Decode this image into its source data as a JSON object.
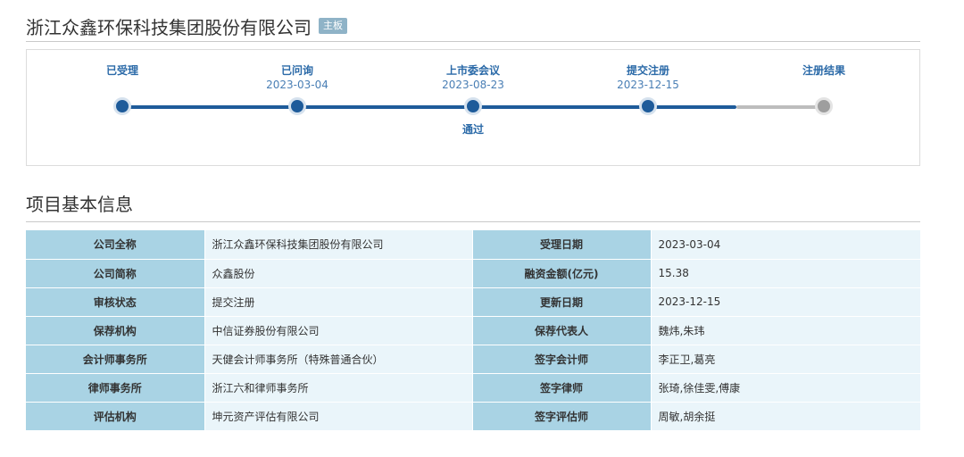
{
  "header": {
    "company_name": "浙江众鑫环保科技集团股份有限公司",
    "board_badge": "主板"
  },
  "progress": {
    "steps": [
      {
        "label": "已受理",
        "date": "",
        "result": "",
        "status": "done"
      },
      {
        "label": "已问询",
        "date": "2023-03-04",
        "result": "",
        "status": "done"
      },
      {
        "label": "上市委会议",
        "date": "2023-08-23",
        "result": "通过",
        "status": "done"
      },
      {
        "label": "提交注册",
        "date": "2023-12-15",
        "result": "",
        "status": "done"
      },
      {
        "label": "注册结果",
        "date": "",
        "result": "",
        "status": "pending"
      }
    ],
    "colors": {
      "done": "#1e5b9a",
      "pending": "#9e9e9e"
    }
  },
  "section": {
    "title": "项目基本信息"
  },
  "info": {
    "rows": [
      {
        "l1": "公司全称",
        "v1": "浙江众鑫环保科技集团股份有限公司",
        "l2": "受理日期",
        "v2": "2023-03-04"
      },
      {
        "l1": "公司简称",
        "v1": "众鑫股份",
        "l2": "融资金额(亿元)",
        "v2": "15.38"
      },
      {
        "l1": "审核状态",
        "v1": "提交注册",
        "l2": "更新日期",
        "v2": "2023-12-15"
      },
      {
        "l1": "保荐机构",
        "v1": "中信证券股份有限公司",
        "l2": "保荐代表人",
        "v2": "魏炜,朱玮"
      },
      {
        "l1": "会计师事务所",
        "v1": "天健会计师事务所（特殊普通合伙）",
        "l2": "签字会计师",
        "v2": "李正卫,葛亮"
      },
      {
        "l1": "律师事务所",
        "v1": "浙江六和律师事务所",
        "l2": "签字律师",
        "v2": "张琦,徐佳雯,傅康"
      },
      {
        "l1": "评估机构",
        "v1": "坤元资产评估有限公司",
        "l2": "签字评估师",
        "v2": "周敏,胡余挺"
      }
    ]
  }
}
